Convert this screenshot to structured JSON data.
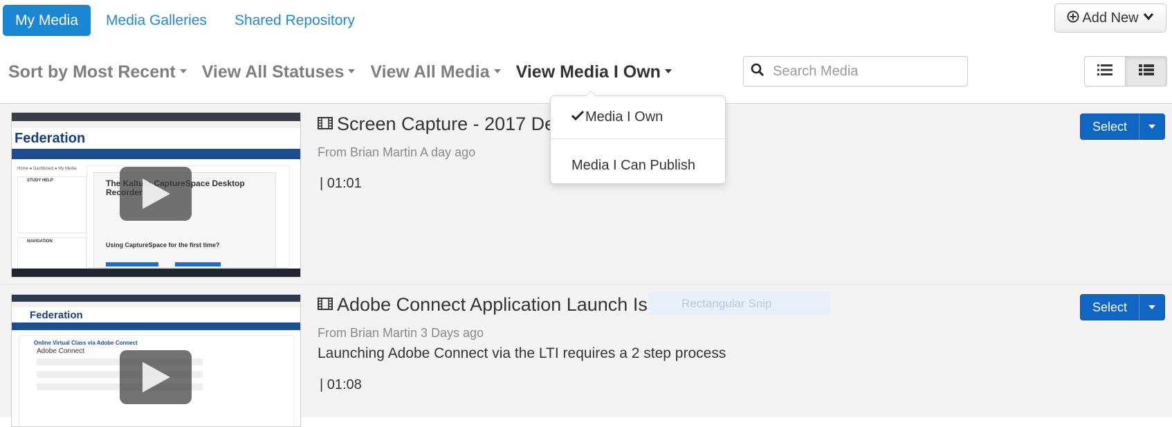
{
  "tabs": [
    {
      "label": "My Media",
      "active": true
    },
    {
      "label": "Media Galleries",
      "active": false
    },
    {
      "label": "Shared Repository",
      "active": false
    }
  ],
  "add_new": {
    "label": "Add New"
  },
  "filters": {
    "sort": "Sort by Most Recent",
    "statuses": "View All Statuses",
    "media": "View All Media",
    "own": "View Media I Own"
  },
  "search": {
    "placeholder": "Search Media",
    "value": ""
  },
  "dropdown": {
    "items": [
      {
        "label": "Media I Own",
        "checked": true
      },
      {
        "label": "Media I Can Publish",
        "checked": false
      }
    ]
  },
  "entries": [
    {
      "title": "Screen Capture - 2017 De",
      "meta": "From Brian Martin A day ago",
      "description": "",
      "duration": "| 01:01",
      "select_label": "Select",
      "thumb": {
        "brand": "Federation",
        "heading": "The Kaltura CaptureSpace Desktop Recorder",
        "sub": "Using CaptureSpace for the first time?",
        "side_head": "STUDY HELP",
        "nav_head": "NAVIGATION"
      }
    },
    {
      "title": "Adobe Connect Application Launch Issue",
      "meta": "From Brian Martin 3 Days ago",
      "description": "Launching Adobe Connect via the LTI requires a 2 step process",
      "duration": "| 01:08",
      "select_label": "Select",
      "thumb": {
        "brand": "Federation",
        "heading": "Adobe Connect"
      }
    }
  ],
  "snip_label": "Rectangular Snip",
  "colors": {
    "accent": "#1b86d1",
    "select": "#1165c3",
    "link": "#1f89d6"
  }
}
